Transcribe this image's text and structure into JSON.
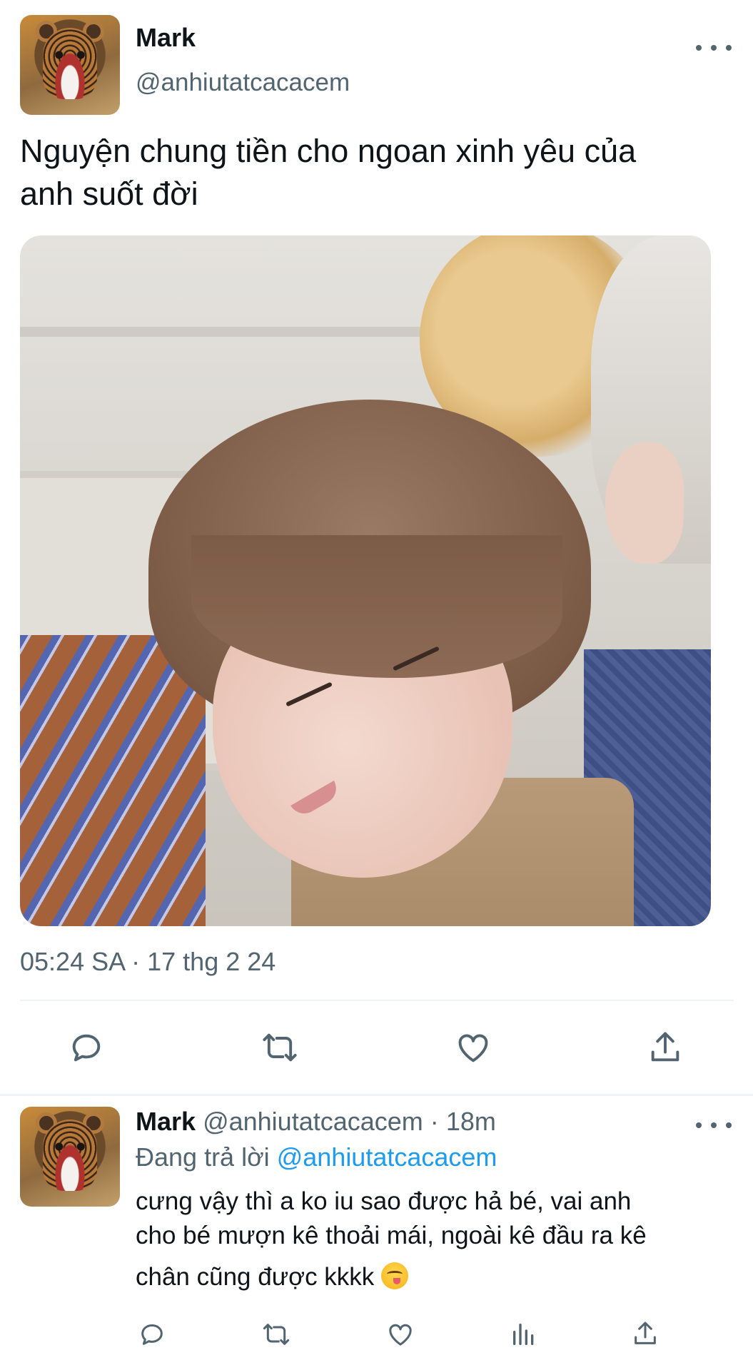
{
  "tweet": {
    "author_name": "Mark",
    "author_handle": "@anhiutatcacacem",
    "text_line1": "Nguyện chung tiền cho ngoan xinh yêu của",
    "text_line2": "anh suốt đời",
    "timestamp": "05:24 SA · 17 thg 2 24",
    "more_icon": "more-horizontal-icon",
    "actions": [
      "reply-icon",
      "retweet-icon",
      "like-icon",
      "share-icon"
    ]
  },
  "reply": {
    "author_name": "Mark",
    "author_handle": "@anhiutatcacacem",
    "dot": "·",
    "time": "18m",
    "replying_prefix": "Đang trả lời",
    "replying_to": "@anhiutatcacacem",
    "text_line1": "cưng vậy thì a ko iu sao được hả bé, vai anh",
    "text_line2": "cho bé mượn kê thoải mái, ngoài kê đầu ra kê",
    "text_line3": "chân cũng được kkkk",
    "emoji": "face-savoring-food-emoji",
    "more_icon": "more-horizontal-icon",
    "actions": [
      "reply-icon",
      "retweet-icon",
      "like-icon",
      "analytics-icon",
      "share-icon"
    ]
  },
  "colors": {
    "text": "#0f1419",
    "secondary": "#536471",
    "link": "#1d9bf0",
    "divider": "#eff3f4"
  }
}
